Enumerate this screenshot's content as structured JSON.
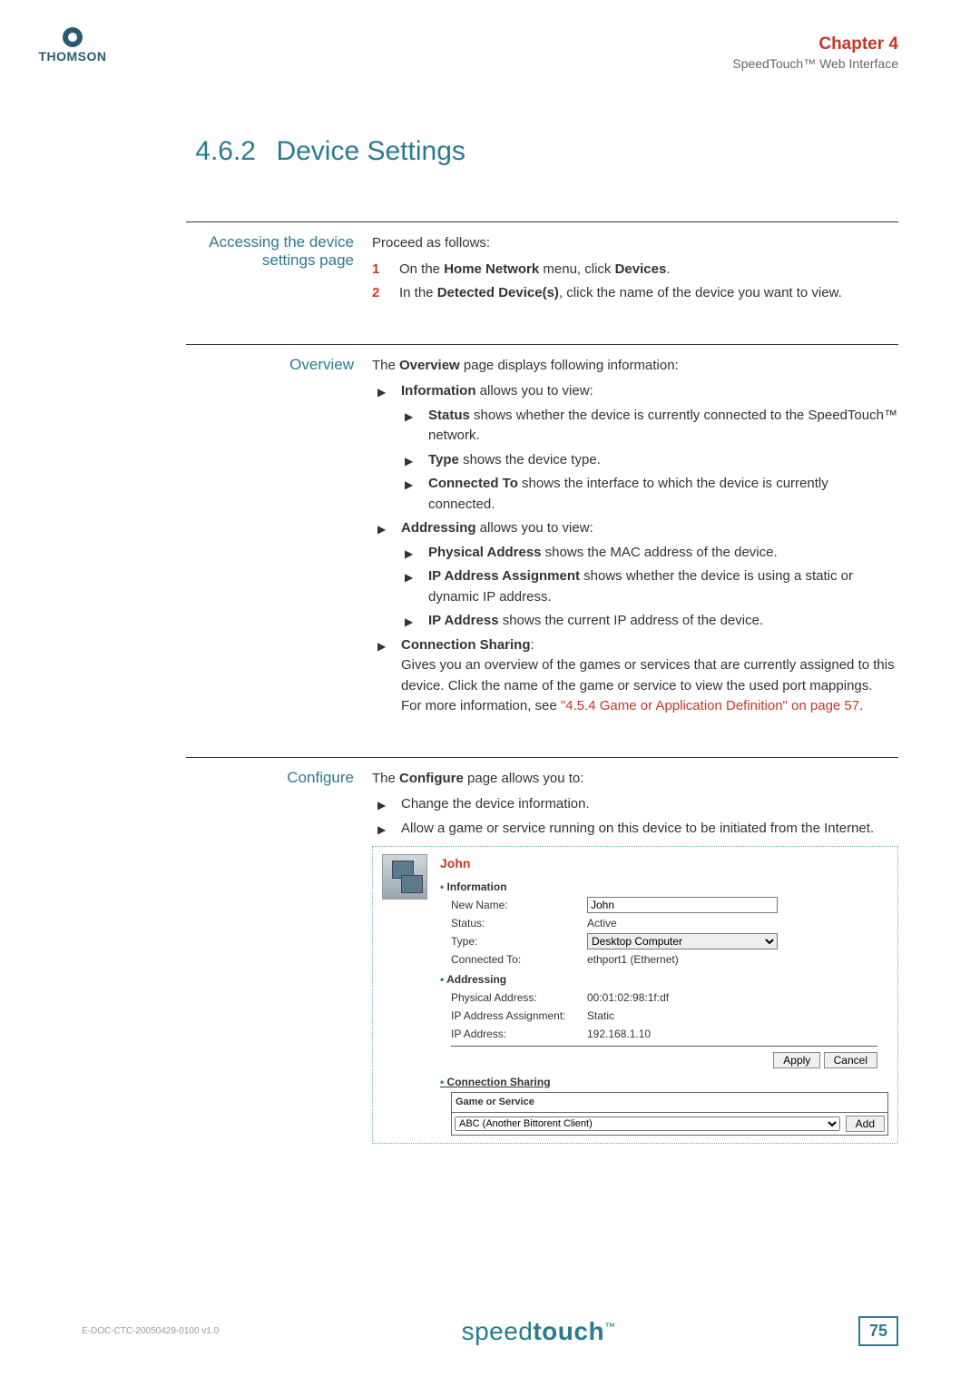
{
  "brand": "THOMSON",
  "header": {
    "chapter": "Chapter 4",
    "subtitle": "SpeedTouch™ Web Interface"
  },
  "section": {
    "number": "4.6.2",
    "title": "Device Settings"
  },
  "accessing": {
    "label": "Accessing the device settings page",
    "intro": "Proceed as follows:",
    "step1_prefix": "On the ",
    "step1_bold1": "Home Network",
    "step1_mid": " menu, click ",
    "step1_bold2": "Devices",
    "step1_suffix": ".",
    "step2_prefix": "In the ",
    "step2_bold": "Detected Device(s)",
    "step2_suffix": ", click the name of the device you want to view."
  },
  "overview": {
    "label": "Overview",
    "intro_pre": "The ",
    "intro_bold": "Overview",
    "intro_post": " page displays following information:",
    "info_bold": "Information",
    "info_post": " allows you to view:",
    "status_bold": "Status",
    "status_post": " shows whether the device is currently connected to the SpeedTouch™ network.",
    "type_bold": "Type",
    "type_post": " shows the device type.",
    "conn_bold": "Connected To",
    "conn_post": " shows the interface to which the device is currently connected.",
    "addr_bold": "Addressing",
    "addr_post": " allows you to view:",
    "phys_bold": "Physical Address",
    "phys_post": " shows the MAC address of the device.",
    "ipassign_bold": "IP Address Assignment",
    "ipassign_post": " shows whether the device is using a static or dynamic IP address.",
    "ipaddr_bold": "IP Address",
    "ipaddr_post": " shows the current IP address of the device.",
    "share_bold": "Connection Sharing",
    "share_colon": ":",
    "share_text": "Gives you an overview of the games or services that are currently assigned to this device. Click the name of the game or service to view the used port mappings.",
    "share_more_pre": "For more information, see ",
    "share_link": "\"4.5.4 Game or Application Definition\" on page 57",
    "share_more_post": "."
  },
  "configure": {
    "label": "Configure",
    "intro_pre": "The ",
    "intro_bold": "Configure",
    "intro_post": " page allows you to:",
    "item1": "Change the device information.",
    "item2": "Allow a game or service running on this device to be initiated from the Internet."
  },
  "panel": {
    "device_name": "John",
    "information_label": "Information",
    "new_name_label": "New Name:",
    "new_name_value": "John",
    "status_label": "Status:",
    "status_value": "Active",
    "type_label": "Type:",
    "type_value": "Desktop Computer",
    "connected_label": "Connected To:",
    "connected_value": "ethport1 (Ethernet)",
    "addressing_label": "Addressing",
    "phys_label": "Physical Address:",
    "phys_value": "00:01:02:98:1f:df",
    "ipassign_label": "IP Address Assignment:",
    "ipassign_value": "Static",
    "ipaddr_label": "IP Address:",
    "ipaddr_value": "192.168.1.10",
    "apply": "Apply",
    "cancel": "Cancel",
    "conn_sharing_label": "Connection Sharing",
    "game_or_service": "Game or Service",
    "gs_select": "ABC (Another Bittorent Client)",
    "add": "Add"
  },
  "footer": {
    "docid": "E-DOC-CTC-20050429-0100 v1.0",
    "logo_light": "speed",
    "logo_bold": "touch",
    "tm": "™",
    "page": "75"
  }
}
